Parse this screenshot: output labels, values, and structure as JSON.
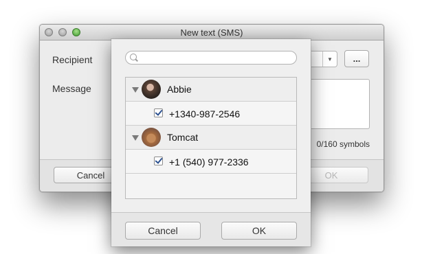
{
  "window": {
    "title": "New text (SMS)",
    "recipient_label": "Recipient",
    "message_label": "Message",
    "more_label": "...",
    "symbol_count": "0/160 symbols",
    "cancel_label": "Cancel",
    "ok_label": "OK"
  },
  "popup": {
    "search_placeholder": "",
    "contacts": [
      {
        "name": "Abbie",
        "avatar": "abbie-photo",
        "phone": "+1340-987-2546",
        "checked": true
      },
      {
        "name": "Tomcat",
        "avatar": "tomcat-photo",
        "phone": "+1 (540) 977-2336",
        "checked": true
      }
    ],
    "cancel_label": "Cancel",
    "ok_label": "OK"
  }
}
